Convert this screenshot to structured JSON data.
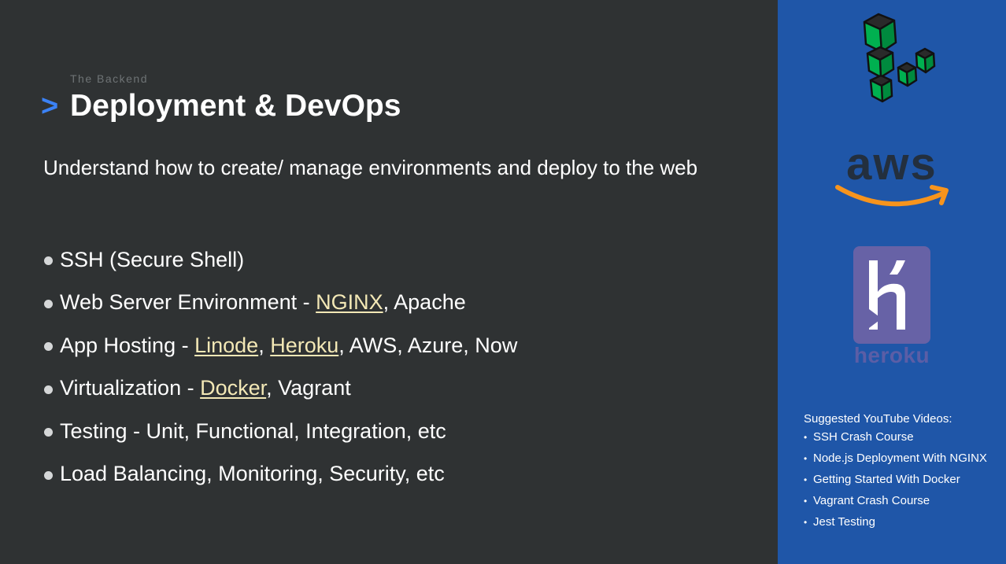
{
  "slide": {
    "eyebrow": "The Backend",
    "chevron": ">",
    "title": "Deployment & DevOps",
    "subtitle": "Understand how to create/ manage environments and deploy to the web"
  },
  "bullets": [
    {
      "segments": [
        {
          "text": "SSH (Secure Shell)",
          "link": false
        }
      ]
    },
    {
      "segments": [
        {
          "text": "Web Server Environment - ",
          "link": false
        },
        {
          "text": "NGINX",
          "link": true
        },
        {
          "text": ", Apache",
          "link": false
        }
      ]
    },
    {
      "segments": [
        {
          "text": "App Hosting - ",
          "link": false
        },
        {
          "text": "Linode",
          "link": true
        },
        {
          "text": ", ",
          "link": false
        },
        {
          "text": "Heroku",
          "link": true
        },
        {
          "text": ", AWS, Azure, Now",
          "link": false
        }
      ]
    },
    {
      "segments": [
        {
          "text": "Virtualization - ",
          "link": false
        },
        {
          "text": "Docker",
          "link": true
        },
        {
          "text": ", Vagrant",
          "link": false
        }
      ]
    },
    {
      "segments": [
        {
          "text": "Testing - Unit, Functional, Integration, etc",
          "link": false
        }
      ]
    },
    {
      "segments": [
        {
          "text": "Load Balancing, Monitoring, Security, etc",
          "link": false
        }
      ]
    }
  ],
  "sidebar": {
    "logos": {
      "linode": "linode-logo-icon",
      "aws_text": "aws",
      "heroku_text": "heroku"
    },
    "videos_heading": "Suggested YouTube Videos:",
    "videos": [
      "SSH Crash Course",
      "Node.js Deployment With NGINX",
      "Getting Started With Docker",
      "Vagrant Crash Course",
      "Jest Testing"
    ]
  },
  "colors": {
    "background": "#2f3233",
    "sidebar": "#1f56a8",
    "accent_chevron": "#3b82f6",
    "link": "#f3e8b6",
    "aws_orange": "#f7941d",
    "heroku_purple": "#6762a6"
  }
}
